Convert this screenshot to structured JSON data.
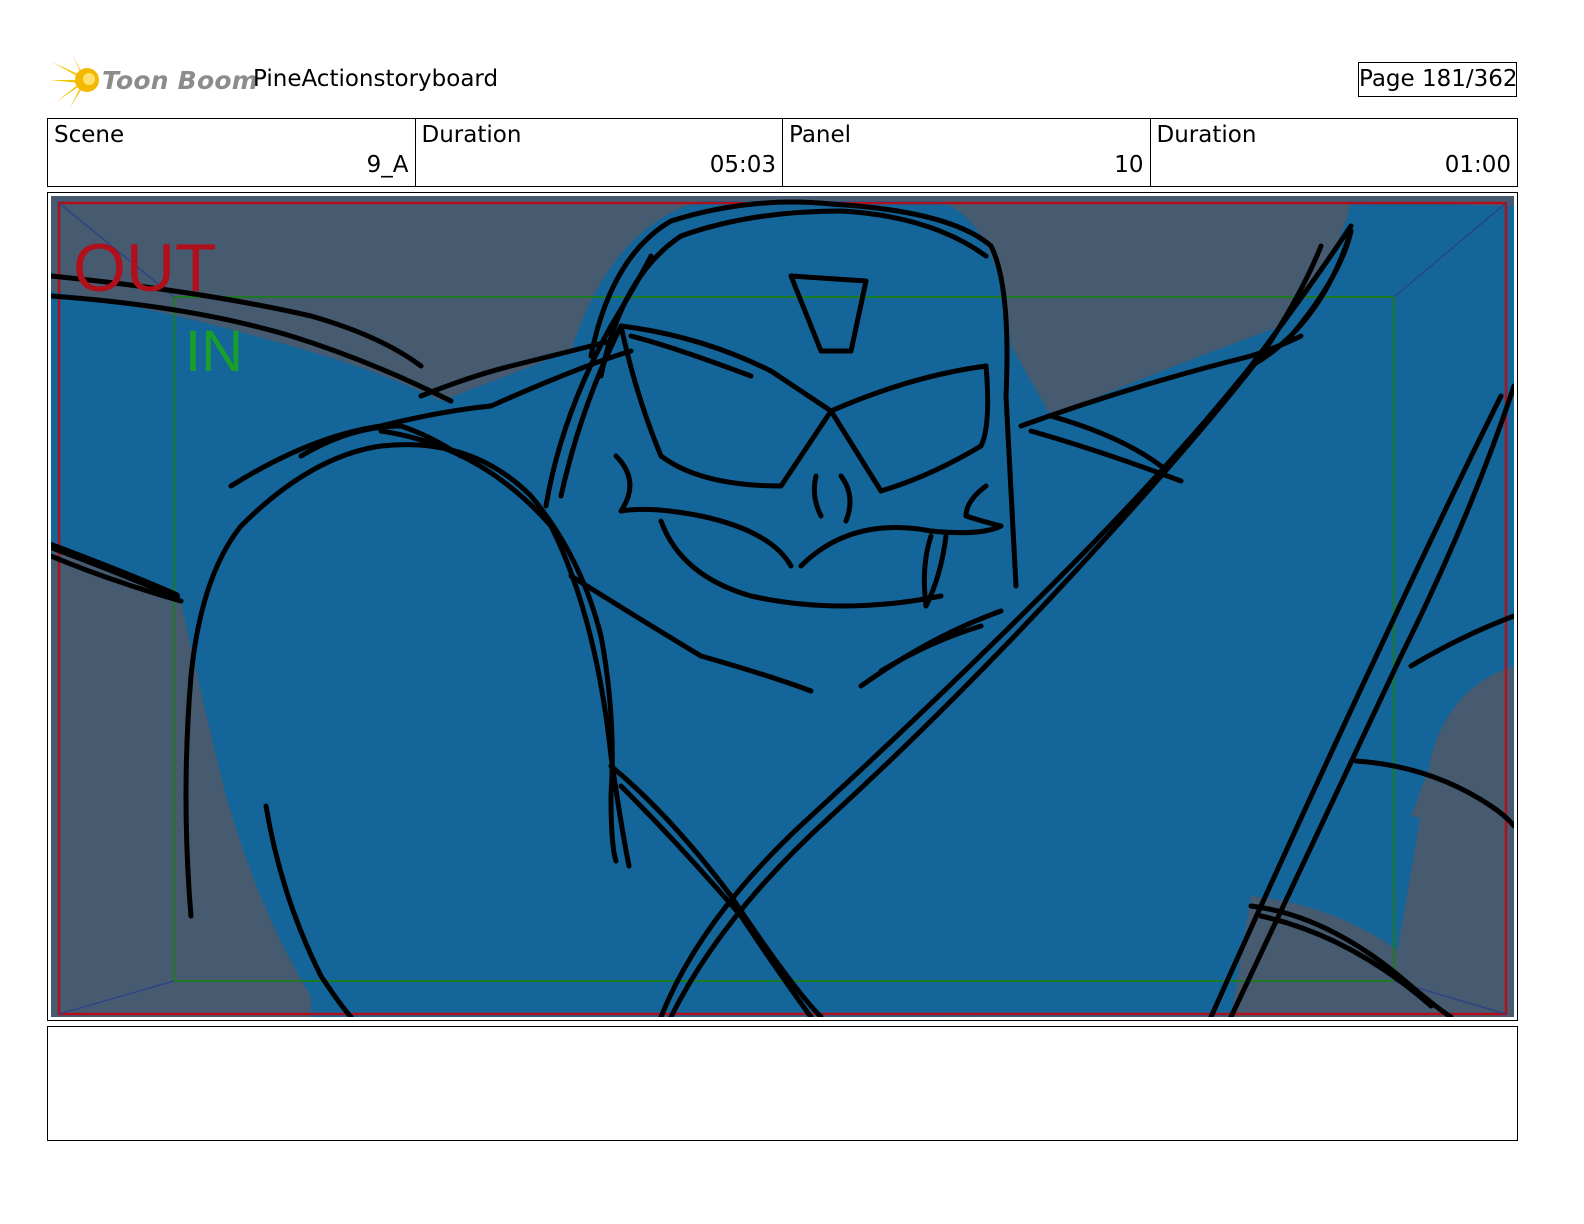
{
  "header": {
    "logo_text": "Toon Boom",
    "project_title": "PineActionstoryboard",
    "page_label": "Page 181/362"
  },
  "info": {
    "scene_label": "Scene",
    "scene_value": "9_A",
    "scene_duration_label": "Duration",
    "scene_duration_value": "05:03",
    "panel_label": "Panel",
    "panel_value": "10",
    "panel_duration_label": "Duration",
    "panel_duration_value": "01:00"
  },
  "panel": {
    "out_label": "OUT",
    "in_label": "IN"
  },
  "notes": {
    "text": ""
  },
  "colors": {
    "sky": "#465b70",
    "body_fill": "#13659a",
    "out_frame": "#b0101c",
    "in_frame": "#1b7a22",
    "linework": "#000000"
  }
}
